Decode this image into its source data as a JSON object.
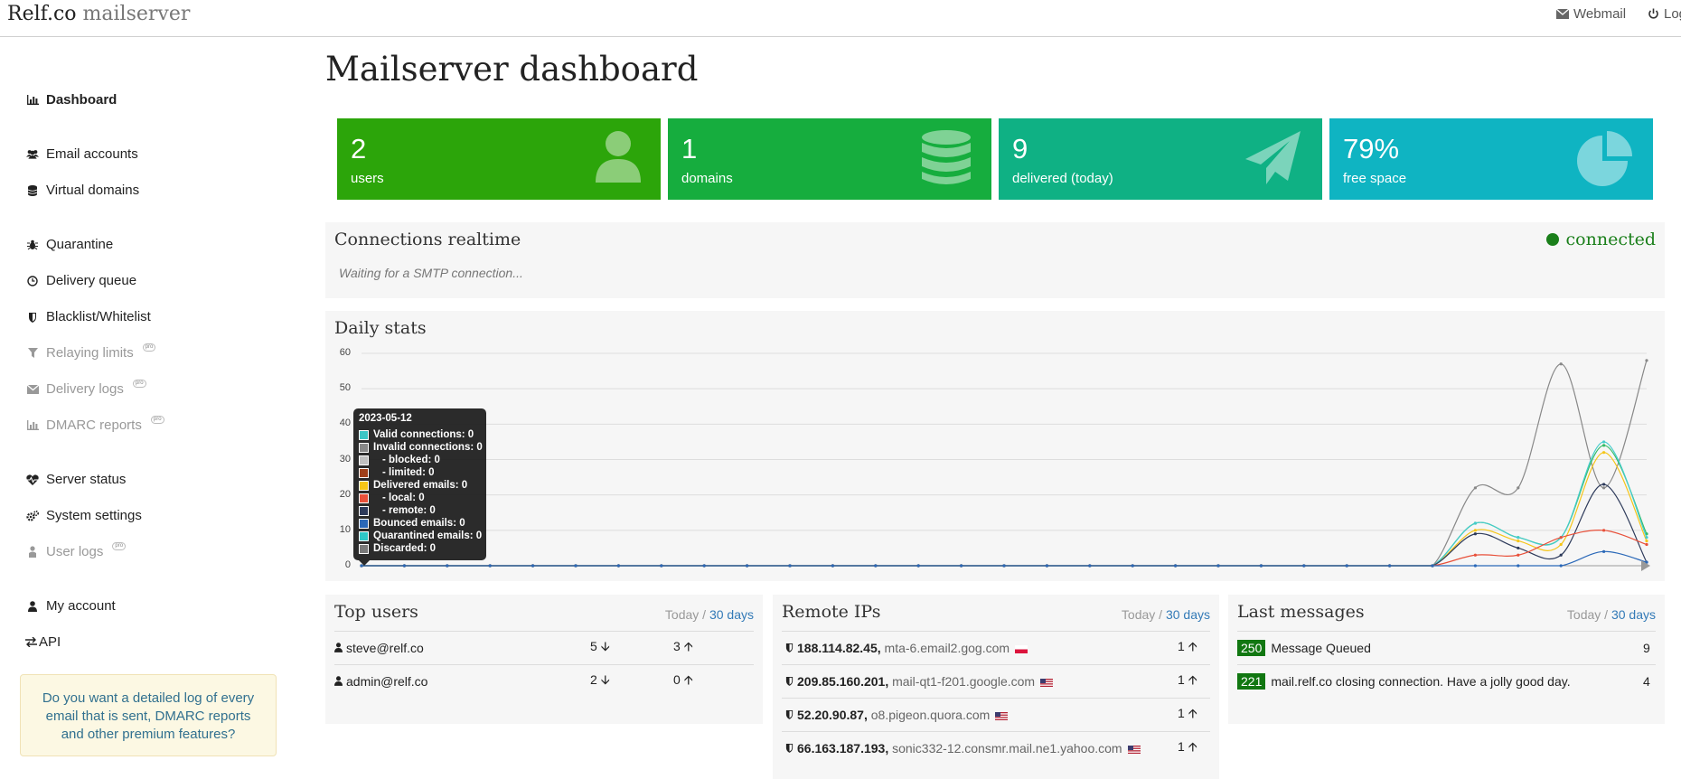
{
  "header": {
    "brand": "Relf.co",
    "brand_suffix": "mailserver",
    "webmail": "Webmail",
    "logout": "Log"
  },
  "sidebar": {
    "items": [
      {
        "label": "Dashboard",
        "icon": "bar-chart-icon"
      },
      {
        "label": "Email accounts",
        "icon": "users-icon"
      },
      {
        "label": "Virtual domains",
        "icon": "database-icon"
      },
      {
        "label": "Quarantine",
        "icon": "bug-icon"
      },
      {
        "label": "Delivery queue",
        "icon": "clock-icon"
      },
      {
        "label": "Blacklist/Whitelist",
        "icon": "shield-icon"
      },
      {
        "label": "Relaying limits",
        "icon": "filter-icon",
        "pro": "pro"
      },
      {
        "label": "Delivery logs",
        "icon": "envelope-icon",
        "pro": "pro"
      },
      {
        "label": "DMARC reports",
        "icon": "bar-chart-icon",
        "pro": "pro"
      },
      {
        "label": "Server status",
        "icon": "heartbeat-icon"
      },
      {
        "label": "System settings",
        "icon": "cogs-icon"
      },
      {
        "label": "User logs",
        "icon": "user-logs-icon",
        "pro": "pro"
      },
      {
        "label": "My account",
        "icon": "user-icon"
      },
      {
        "label": "API",
        "icon": "exchange-icon"
      }
    ],
    "promo": "Do you want a detailed log of every email that is sent, DMARC reports and other premium features?"
  },
  "page_title": "Mailserver dashboard",
  "stats": [
    {
      "value": "2",
      "label": "users",
      "color": "#2ca50a",
      "icon": "user-icon"
    },
    {
      "value": "1",
      "label": "domains",
      "color": "#16ad3e",
      "icon": "database-icon"
    },
    {
      "value": "9",
      "label": "delivered (today)",
      "color": "#0fb184",
      "icon": "paper-plane-icon"
    },
    {
      "value": "79%",
      "label": "free space",
      "color": "#0fb4c2",
      "icon": "pie-chart-icon"
    }
  ],
  "connections": {
    "title": "Connections realtime",
    "status": "connected",
    "waiting": "Waiting for a SMTP connection..."
  },
  "daily": {
    "title": "Daily stats",
    "tooltip": {
      "date": "2023-05-12",
      "lines": [
        {
          "text": "Valid connections: 0",
          "color": "#3cc6c6"
        },
        {
          "text": "Invalid connections: 0",
          "color": "#888888"
        },
        {
          "text": "- blocked: 0",
          "color": "#c0c0c0"
        },
        {
          "text": "- limited: 0",
          "color": "#a0401a"
        },
        {
          "text": "Delivered emails: 0",
          "color": "#f5c518"
        },
        {
          "text": "- local: 0",
          "color": "#e8503a"
        },
        {
          "text": "- remote: 0",
          "color": "#2d3a5a"
        },
        {
          "text": "Bounced emails: 0",
          "color": "#2a68b8"
        },
        {
          "text": "Quarantined emails: 0",
          "color": "#2ec7c7"
        },
        {
          "text": "Discarded: 0",
          "color": "#7a7a7a"
        }
      ]
    }
  },
  "chart_data": {
    "type": "line",
    "x_count": 31,
    "ylim": [
      0,
      60
    ],
    "yticks": [
      0,
      10,
      20,
      30,
      40,
      50,
      60
    ],
    "grid": true,
    "series": [
      {
        "color": "#888888",
        "values": [
          0,
          0,
          0,
          0,
          0,
          0,
          0,
          0,
          0,
          0,
          0,
          0,
          0,
          0,
          0,
          0,
          0,
          0,
          0,
          0,
          0,
          0,
          0,
          0,
          0,
          0,
          22,
          22,
          57,
          22,
          58
        ]
      },
      {
        "color": "#33bb66",
        "values": [
          0,
          0,
          0,
          0,
          0,
          0,
          0,
          0,
          0,
          0,
          0,
          0,
          0,
          0,
          0,
          0,
          0,
          0,
          0,
          0,
          0,
          0,
          0,
          0,
          0,
          0,
          12,
          8,
          8,
          34,
          9
        ]
      },
      {
        "color": "#f5c518",
        "values": [
          0,
          0,
          0,
          0,
          0,
          0,
          0,
          0,
          0,
          0,
          0,
          0,
          0,
          0,
          0,
          0,
          0,
          0,
          0,
          0,
          0,
          0,
          0,
          0,
          0,
          0,
          10,
          7,
          6,
          32,
          7
        ]
      },
      {
        "color": "#44cccc",
        "values": [
          0,
          0,
          0,
          0,
          0,
          0,
          0,
          0,
          0,
          0,
          0,
          0,
          0,
          0,
          0,
          0,
          0,
          0,
          0,
          0,
          0,
          0,
          0,
          0,
          0,
          0,
          12,
          8,
          8,
          35,
          8
        ]
      },
      {
        "color": "#2d3a5a",
        "values": [
          0,
          0,
          0,
          0,
          0,
          0,
          0,
          0,
          0,
          0,
          0,
          0,
          0,
          0,
          0,
          0,
          0,
          0,
          0,
          0,
          0,
          0,
          0,
          0,
          0,
          0,
          9,
          5,
          3,
          23,
          1
        ]
      },
      {
        "color": "#e8503a",
        "values": [
          0,
          0,
          0,
          0,
          0,
          0,
          0,
          0,
          0,
          0,
          0,
          0,
          0,
          0,
          0,
          0,
          0,
          0,
          0,
          0,
          0,
          0,
          0,
          0,
          0,
          0,
          3,
          3,
          8,
          10,
          6
        ]
      },
      {
        "color": "#2a68b8",
        "values": [
          0,
          0,
          0,
          0,
          0,
          0,
          0,
          0,
          0,
          0,
          0,
          0,
          0,
          0,
          0,
          0,
          0,
          0,
          0,
          0,
          0,
          0,
          0,
          0,
          0,
          0,
          0,
          0,
          0,
          4,
          1
        ]
      }
    ]
  },
  "top_users": {
    "title": "Top users",
    "today": "Today",
    "sep": "/",
    "days": "30 days",
    "rows": [
      {
        "user": "steve@relf.co",
        "down": "5",
        "up": "3"
      },
      {
        "user": "admin@relf.co",
        "down": "2",
        "up": "0"
      }
    ]
  },
  "remote_ips": {
    "title": "Remote IPs",
    "today": "Today",
    "sep": "/",
    "days": "30 days",
    "rows": [
      {
        "ip": "188.114.82.45,",
        "host": "mta-6.email2.gog.com",
        "flag": "pl",
        "count": "1"
      },
      {
        "ip": "209.85.160.201,",
        "host": "mail-qt1-f201.google.com",
        "flag": "us",
        "count": "1"
      },
      {
        "ip": "52.20.90.87,",
        "host": "o8.pigeon.quora.com",
        "flag": "us",
        "count": "1"
      },
      {
        "ip": "66.163.187.193,",
        "host": "sonic332-12.consmr.mail.ne1.yahoo.com",
        "flag": "us",
        "count": "1"
      }
    ]
  },
  "last_messages": {
    "title": "Last messages",
    "today": "Today",
    "sep": "/",
    "days": "30 days",
    "rows": [
      {
        "code": "250",
        "text": "Message Queued",
        "count": "9"
      },
      {
        "code": "221",
        "text": "mail.relf.co closing connection. Have a jolly good day.",
        "count": "4"
      }
    ]
  }
}
